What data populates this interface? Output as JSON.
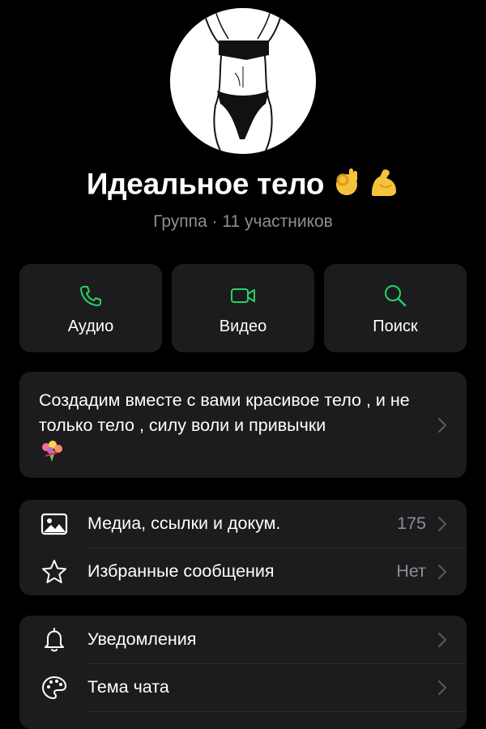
{
  "group": {
    "name": "Идеальное тело",
    "emojis": [
      "ok-hand-emoji",
      "flexed-biceps-emoji"
    ],
    "subtitle": "Группа · 11 участников"
  },
  "actions": [
    {
      "label": "Аудио",
      "icon": "phone-icon"
    },
    {
      "label": "Видео",
      "icon": "video-camera-icon"
    },
    {
      "label": "Поиск",
      "icon": "search-icon"
    }
  ],
  "description": {
    "text": "Создадим вместе с вами красивое тело , и не только тело , силу воли и привычки",
    "emoji": "bouquet-emoji"
  },
  "media_section": [
    {
      "label": "Медиа, ссылки и докум.",
      "value": "175",
      "icon": "image-icon"
    },
    {
      "label": "Избранные сообщения",
      "value": "Нет",
      "icon": "star-icon"
    }
  ],
  "settings_section": [
    {
      "label": "Уведомления",
      "icon": "bell-icon"
    },
    {
      "label": "Тема чата",
      "icon": "palette-icon"
    }
  ],
  "colors": {
    "background": "#000000",
    "card": "#1c1c1e",
    "accent_green": "#25d366",
    "secondary_text": "#8e8e93",
    "chevron": "#5a5a5e"
  }
}
